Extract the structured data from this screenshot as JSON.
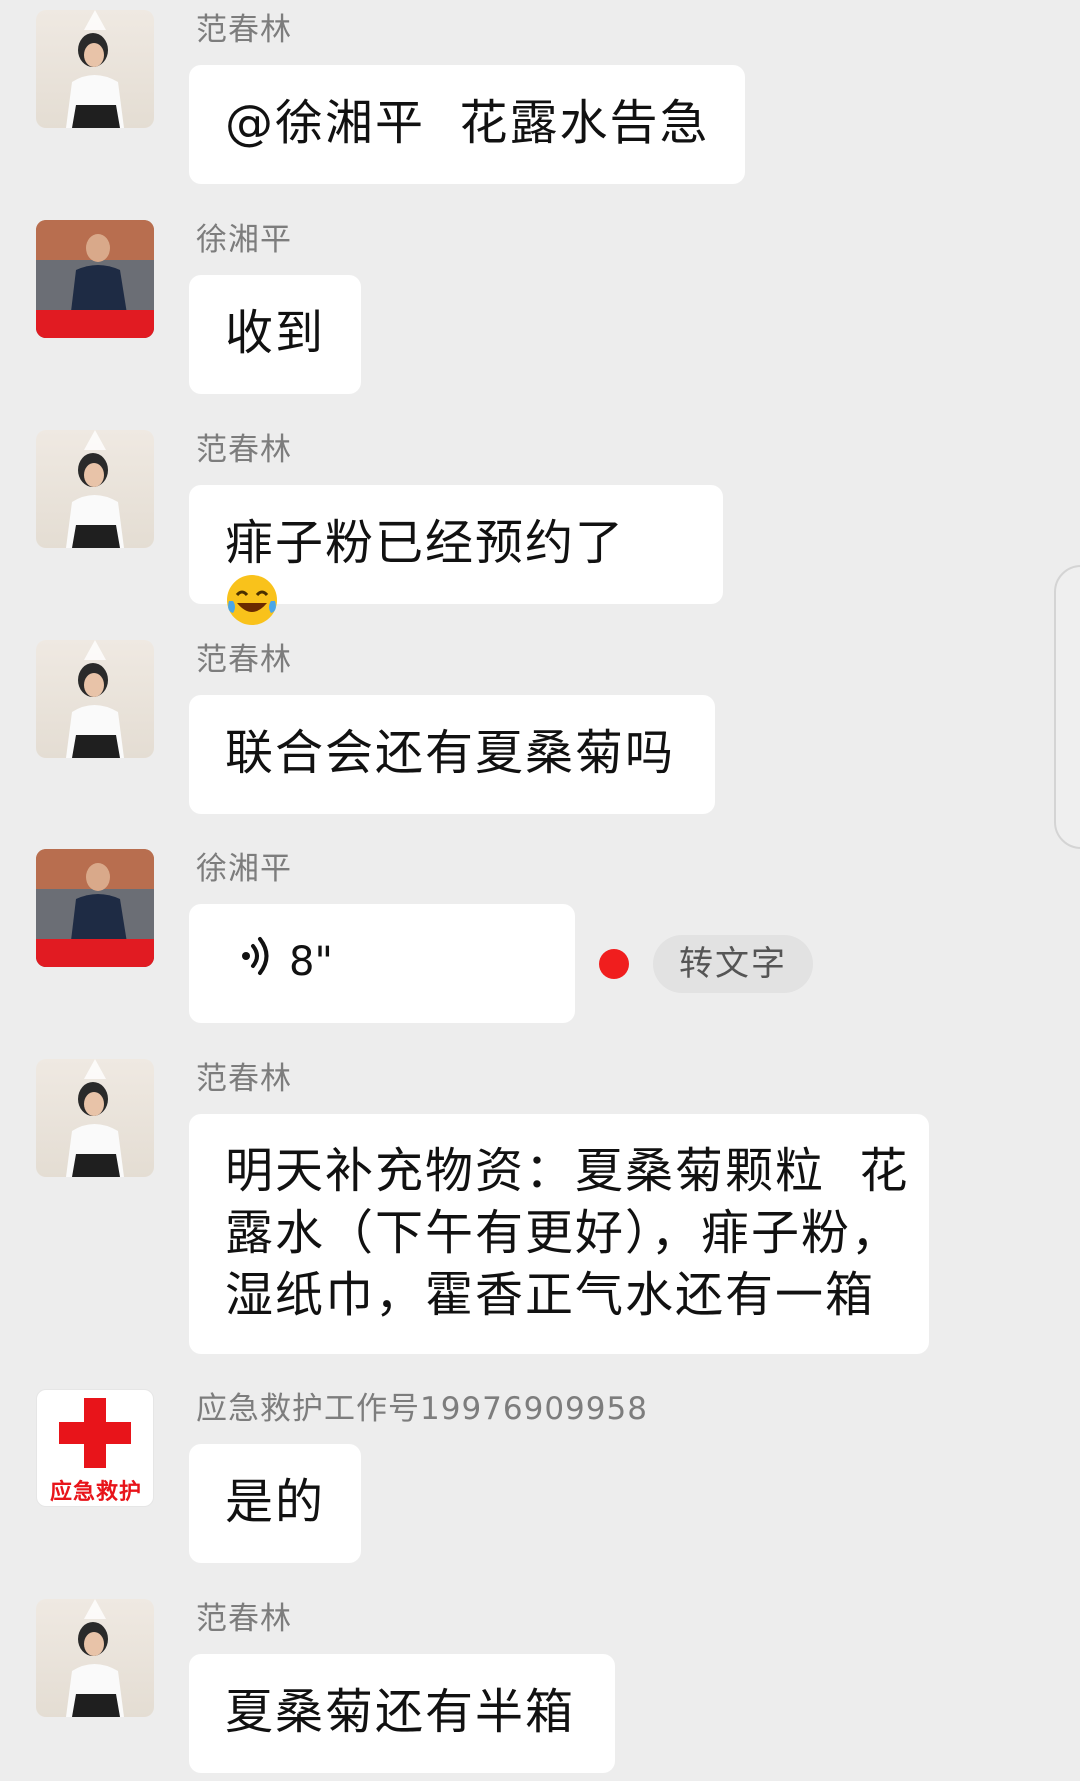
{
  "messages": [
    {
      "sender": "范春林",
      "text": "@徐湘平  花露水告急"
    },
    {
      "sender": "徐湘平",
      "text": "收到"
    },
    {
      "sender": "范春林",
      "text": "痱子粉已经预约了"
    },
    {
      "sender": "范春林",
      "text": "联合会还有夏桑菊吗"
    },
    {
      "sender": "徐湘平",
      "voice_duration": "8\"",
      "convert_label": "转文字"
    },
    {
      "sender": "范春林",
      "lines": [
        "明天补充物资：夏桑菊颗粒  花",
        "露水（下午有更好），痱子粉，",
        "湿纸巾，霍香正气水还有一箱"
      ]
    },
    {
      "sender": "应急救护工作号19976909958",
      "text": "是的",
      "avatar_label": "应急救护"
    },
    {
      "sender": "范春林",
      "text": "夏桑菊还有半箱"
    }
  ],
  "icons": {
    "emoji": "face-with-tears-of-joy-icon",
    "voice": "voice-waves-icon",
    "unread": "unread-red-dot",
    "red_cross": "red-cross-icon"
  },
  "colors": {
    "background": "#ededed",
    "bubble": "#ffffff",
    "sender_name": "#7d7d7d",
    "unread_dot": "#f01e1e",
    "red_cross": "#e8141a"
  }
}
